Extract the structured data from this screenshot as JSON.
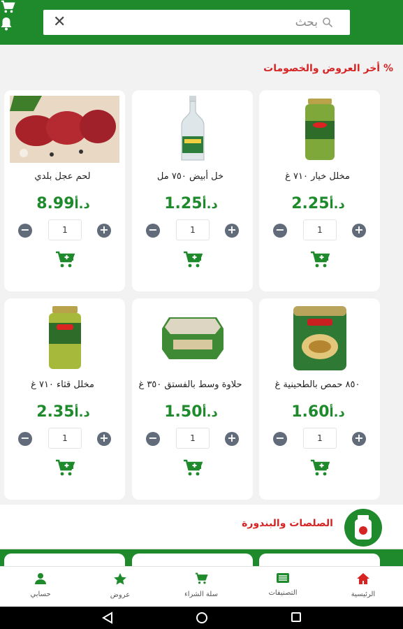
{
  "colors": {
    "primary": "#1e8a2b",
    "accent": "#d62424",
    "qty_button": "#616b7a"
  },
  "header": {
    "search_placeholder": "بحث",
    "clear_icon": "close-icon",
    "cart_icon": "cart-icon",
    "notify_icon": "bell-icon"
  },
  "offers": {
    "title": "% أخر العروض والخصومات",
    "currency": "د.أ",
    "products": [
      {
        "name": "مخلل خيار ٧١٠ غ",
        "price": "2.25",
        "qty": "1",
        "image": "pickled-cucumber-jar"
      },
      {
        "name": "خل أبيض ٧٥٠ مل",
        "price": "1.25",
        "qty": "1",
        "image": "white-vinegar-bottle"
      },
      {
        "name": "لحم عجل بلدي",
        "price": "8.99",
        "qty": "1",
        "image": "beef-steaks"
      },
      {
        "name": "٨٥٠ حمص بالطحينية غ",
        "price": "1.60",
        "qty": "1",
        "image": "hummus-can"
      },
      {
        "name": "حلاوة وسط بالفستق ٣٥٠ غ",
        "price": "1.50",
        "qty": "1",
        "image": "halawa-tub"
      },
      {
        "name": "مخلل قثاء ٧١٠ غ",
        "price": "2.35",
        "qty": "1",
        "image": "pickled-cucumber-jar"
      }
    ]
  },
  "category": {
    "title": "الصلصات والبندورة",
    "icon": "sauce-jar-icon"
  },
  "bottom_nav": [
    {
      "label": "الرئيسية",
      "icon": "home-icon"
    },
    {
      "label": "التصنيفات",
      "icon": "categories-icon"
    },
    {
      "label": "سلة الشراء",
      "icon": "cart-icon"
    },
    {
      "label": "عروض",
      "icon": "star-icon"
    },
    {
      "label": "حسابي",
      "icon": "user-icon"
    }
  ]
}
